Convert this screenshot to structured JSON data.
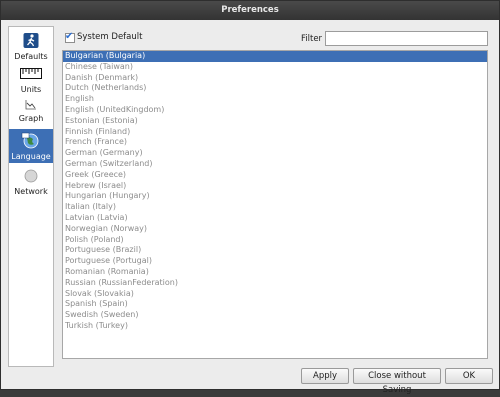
{
  "window": {
    "title": "Preferences"
  },
  "sidebar": {
    "items": [
      {
        "label": "Defaults",
        "icon": "running-figure-icon"
      },
      {
        "label": "Units",
        "icon": "ruler-icon"
      },
      {
        "label": "Graph",
        "icon": "graph-icon"
      },
      {
        "label": "Language",
        "icon": "language-globe-icon",
        "active": true
      },
      {
        "label": "Network",
        "icon": "network-icon"
      }
    ]
  },
  "language": {
    "system_default_label": "System Default",
    "system_default_checked": true,
    "filter_label": "Filter",
    "filter_value": "",
    "languages": [
      "Bulgarian (Bulgaria)",
      "Chinese (Taiwan)",
      "Danish (Denmark)",
      "Dutch (Netherlands)",
      "English",
      "English (UnitedKingdom)",
      "Estonian (Estonia)",
      "Finnish (Finland)",
      "French (France)",
      "German (Germany)",
      "German (Switzerland)",
      "Greek (Greece)",
      "Hebrew (Israel)",
      "Hungarian (Hungary)",
      "Italian (Italy)",
      "Latvian (Latvia)",
      "Norwegian (Norway)",
      "Polish (Poland)",
      "Portuguese (Brazil)",
      "Portuguese (Portugal)",
      "Romanian (Romania)",
      "Russian (RussianFederation)",
      "Slovak (Slovakia)",
      "Spanish (Spain)",
      "Swedish (Sweden)",
      "Turkish (Turkey)"
    ],
    "selected": "Bulgarian (Bulgaria)"
  },
  "buttons": {
    "apply": "Apply",
    "close_without_saving": "Close without Saving",
    "ok": "OK"
  },
  "colors": {
    "selection": "#3d6fb5",
    "checkbox_mark": "#2d6fd0"
  }
}
